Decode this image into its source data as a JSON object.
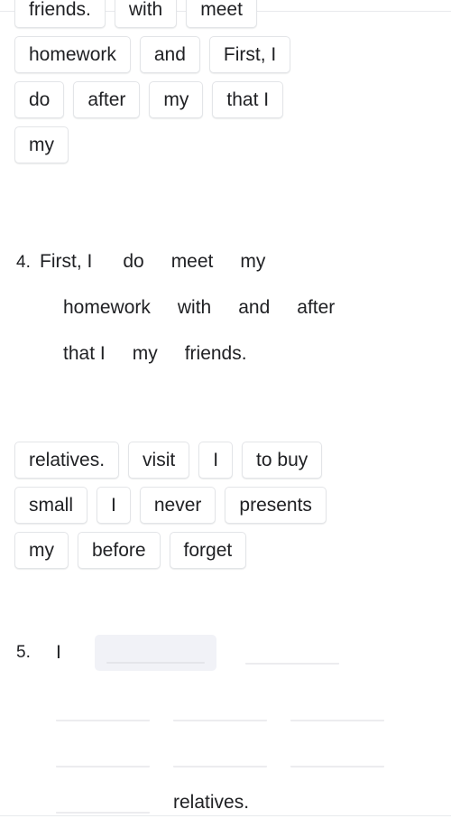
{
  "page": {
    "background": "#ffffff",
    "divider_color": "#e8eaed",
    "chip_border_color": "#e3e5e8",
    "blank_color": "#ececef",
    "active_slot_bg": "#f1f2f7",
    "text_color": "#202124"
  },
  "word_bank_a": {
    "rows": [
      [
        "friends.",
        "with",
        "meet"
      ],
      [
        "homework",
        "and",
        "First, I"
      ],
      [
        "do",
        "after",
        "my",
        "that I"
      ],
      [
        "my"
      ]
    ]
  },
  "question_4": {
    "number": "4.",
    "lines": [
      [
        "First, I",
        "do",
        "meet",
        "my"
      ],
      [
        "homework",
        "with",
        "and",
        "after"
      ],
      [
        "that I",
        "my",
        "friends."
      ]
    ]
  },
  "word_bank_b": {
    "rows": [
      [
        "relatives.",
        "visit",
        "I",
        "to buy"
      ],
      [
        "small",
        "I",
        "never",
        "presents"
      ],
      [
        "my",
        "before",
        "forget"
      ]
    ]
  },
  "question_5": {
    "number": "5.",
    "first_word": "I",
    "last_word": "relatives.",
    "blank_label": "",
    "rows": [
      {
        "type": "first",
        "slots": [
          "active",
          "blank"
        ]
      },
      {
        "type": "blanks",
        "slots": [
          "blank",
          "blank",
          "blank"
        ]
      },
      {
        "type": "blanks",
        "slots": [
          "blank",
          "blank",
          "blank"
        ]
      },
      {
        "type": "final",
        "slots": [
          "blank"
        ]
      }
    ]
  }
}
